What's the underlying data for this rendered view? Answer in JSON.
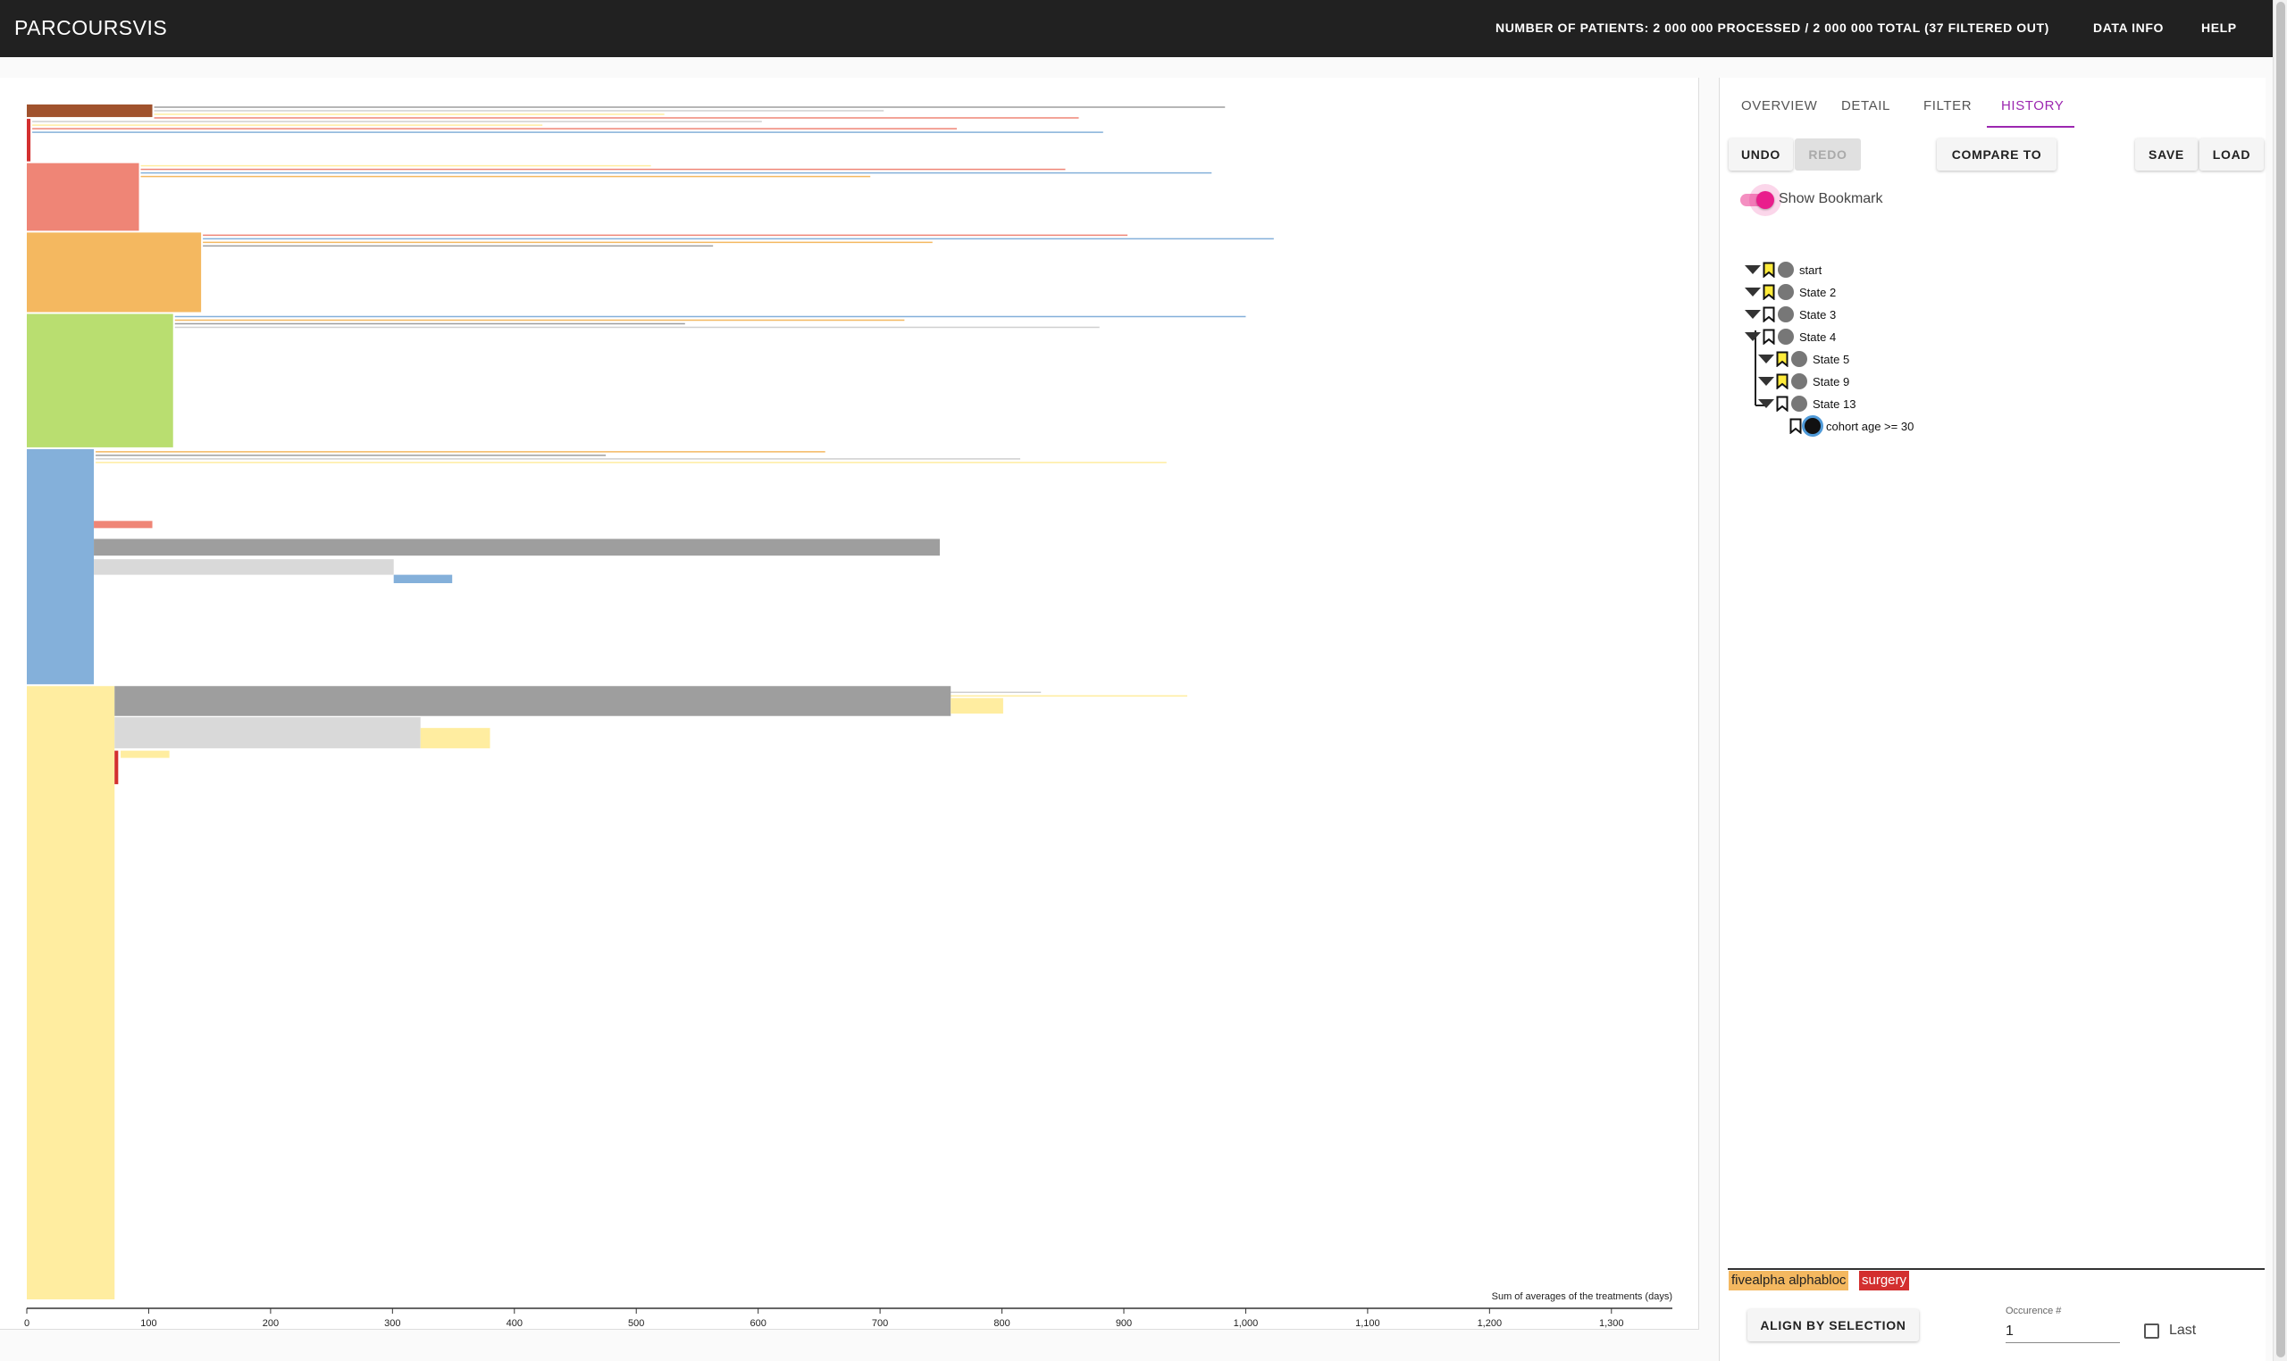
{
  "app": {
    "title": "PARCOURSVIS",
    "patients_status": "NUMBER OF PATIENTS: 2 000 000 PROCESSED / 2 000 000 TOTAL (37 FILTERED OUT)",
    "nav": {
      "data_info": "DATA INFO",
      "help": "HELP"
    }
  },
  "side": {
    "tabs": [
      {
        "label": "OVERVIEW",
        "active": false
      },
      {
        "label": "DETAIL",
        "active": false
      },
      {
        "label": "FILTER",
        "active": false
      },
      {
        "label": "HISTORY",
        "active": true
      }
    ],
    "buttons": {
      "undo": "UNDO",
      "redo": "REDO",
      "compare": "COMPARE TO",
      "save": "SAVE",
      "load": "LOAD"
    },
    "toggle": {
      "label": "Show Bookmark",
      "on": true
    },
    "history": [
      {
        "label": "start",
        "depth": 0,
        "bookmarked": true,
        "expanded": true,
        "current": false
      },
      {
        "label": "State 2",
        "depth": 0,
        "bookmarked": true,
        "expanded": true,
        "current": false
      },
      {
        "label": "State 3",
        "depth": 0,
        "bookmarked": false,
        "expanded": true,
        "current": false
      },
      {
        "label": "State 4",
        "depth": 0,
        "bookmarked": false,
        "expanded": true,
        "current": false
      },
      {
        "label": "State 5",
        "depth": 1,
        "bookmarked": true,
        "expanded": true,
        "current": false
      },
      {
        "label": "State 9",
        "depth": 1,
        "bookmarked": true,
        "expanded": true,
        "current": false
      },
      {
        "label": "State 13",
        "depth": 1,
        "bookmarked": false,
        "expanded": true,
        "current": false
      },
      {
        "label": "cohort age >= 30",
        "depth": 2,
        "bookmarked": false,
        "expanded": false,
        "current": true
      }
    ],
    "legend": [
      {
        "label": "fivealpha alphabloc",
        "color": "#f4b860"
      },
      {
        "label": "surgery",
        "color": "#d32f2f"
      }
    ],
    "align_button": "ALIGN BY SELECTION",
    "occurrence": {
      "label": "Occurence #",
      "value": "1"
    },
    "last_label": "Last"
  },
  "chart_data": {
    "type": "icicle",
    "xlabel": "Sum of averages of the treatments (days)",
    "xlim": [
      0,
      1350
    ],
    "x_ticks": [
      0,
      100,
      200,
      300,
      400,
      500,
      600,
      700,
      800,
      900,
      1000,
      1100,
      1200,
      1300
    ],
    "x_tick_labels": [
      "0",
      "100",
      "200",
      "300",
      "400",
      "500",
      "600",
      "700",
      "800",
      "900",
      "1,000",
      "1,100",
      "1,200",
      "1,300"
    ],
    "root_share_total": 1.0,
    "first_level": [
      {
        "color": "#a0522d",
        "share": 0.012,
        "duration": 103
      },
      {
        "color": "#d32f2f",
        "share": 0.037,
        "duration": 3
      },
      {
        "color": "#ef8576",
        "share": 0.058,
        "duration": 92
      },
      {
        "color": "#f4b860",
        "share": 0.068,
        "duration": 143
      },
      {
        "color": "#b9de70",
        "share": 0.113,
        "duration": 120
      },
      {
        "color": "#84b0da",
        "share": 0.198,
        "duration": 55
      },
      {
        "color": "#ffeda0",
        "share": 0.514,
        "duration": 72
      }
    ],
    "second_level": [
      {
        "parent": 5,
        "color": "#9e9e9e",
        "start": 55,
        "duration": 694,
        "top": 0.075,
        "share": 0.014
      },
      {
        "parent": 5,
        "color": "#d9d9d9",
        "start": 55,
        "duration": 246,
        "top": 0.092,
        "share": 0.013
      },
      {
        "parent": 5,
        "color": "#84b0da",
        "start": 301,
        "duration": 48,
        "top": 0.105,
        "share": 0.007
      },
      {
        "parent": 5,
        "color": "#ef8576",
        "start": 55,
        "duration": 48,
        "top": 0.06,
        "share": 0.006
      },
      {
        "parent": 6,
        "color": "#9e9e9e",
        "start": 72,
        "duration": 686,
        "top": 0.0,
        "share": 0.025
      },
      {
        "parent": 6,
        "color": "#d9d9d9",
        "start": 72,
        "duration": 251,
        "top": 0.026,
        "share": 0.026
      },
      {
        "parent": 6,
        "color": "#ffeda0",
        "start": 758,
        "duration": 43,
        "top": 0.01,
        "share": 0.013
      },
      {
        "parent": 6,
        "color": "#ffeda0",
        "start": 323,
        "duration": 57,
        "top": 0.035,
        "share": 0.017
      },
      {
        "parent": 6,
        "color": "#d32f2f",
        "start": 72,
        "duration": 3,
        "top": 0.054,
        "share": 0.028
      },
      {
        "parent": 6,
        "color": "#ffeda0",
        "start": 77,
        "duration": 40,
        "top": 0.054,
        "share": 0.006
      }
    ]
  }
}
